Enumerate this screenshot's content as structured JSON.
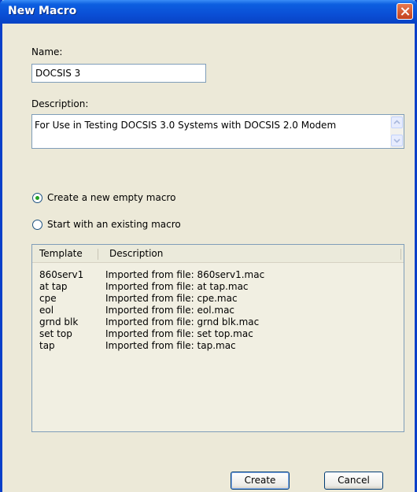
{
  "window": {
    "title": "New Macro"
  },
  "name": {
    "label": "Name:",
    "value": "DOCSIS 3"
  },
  "description": {
    "label": "Description:",
    "value": "For Use in Testing DOCSIS 3.0 Systems with DOCSIS 2.0 Modem"
  },
  "options": {
    "create_new": {
      "label": "Create a new empty macro",
      "selected": true
    },
    "start_existing": {
      "label": "Start with an existing macro",
      "selected": false
    }
  },
  "templates": {
    "columns": [
      "Template",
      "Description"
    ],
    "rows": [
      {
        "template": "860serv1",
        "description": "Imported from file: 860serv1.mac"
      },
      {
        "template": "at tap",
        "description": "Imported from file: at tap.mac"
      },
      {
        "template": "cpe",
        "description": "Imported from file: cpe.mac"
      },
      {
        "template": "eol",
        "description": "Imported from file: eol.mac"
      },
      {
        "template": "grnd blk",
        "description": "Imported from file: grnd blk.mac"
      },
      {
        "template": "set top",
        "description": "Imported from file: set top.mac"
      },
      {
        "template": "tap",
        "description": "Imported from file: tap.mac"
      }
    ]
  },
  "buttons": {
    "create": "Create",
    "cancel": "Cancel"
  }
}
